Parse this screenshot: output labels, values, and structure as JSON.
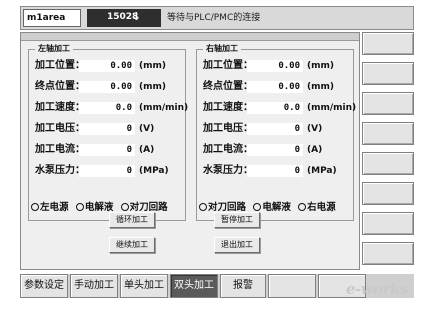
{
  "topbar": {
    "area": "m1area",
    "status_code": "15028",
    "status_arrow": "↓",
    "message": "等待与PLC/PMC的连接"
  },
  "left_group": {
    "title": "左轴加工",
    "rows": [
      {
        "label": "加工位置：",
        "value": "0.00",
        "unit": "(mm)"
      },
      {
        "label": "终点位置：",
        "value": "0.00",
        "unit": "(mm)"
      },
      {
        "label": "加工速度：",
        "value": "0.0",
        "unit": "(mm/min)"
      },
      {
        "label": "加工电压：",
        "value": "0",
        "unit": "(V)"
      },
      {
        "label": "加工电流：",
        "value": "0",
        "unit": "(A)"
      },
      {
        "label": "水泵压力：",
        "value": "0",
        "unit": "(MPa)"
      }
    ],
    "radios": [
      "左电源",
      "电解液",
      "对刀回路"
    ]
  },
  "right_group": {
    "title": "右轴加工",
    "rows": [
      {
        "label": "加工位置：",
        "value": "0.00",
        "unit": "(mm)"
      },
      {
        "label": "终点位置：",
        "value": "0.00",
        "unit": "(mm)"
      },
      {
        "label": "加工速度：",
        "value": "0.0",
        "unit": "(mm/min)"
      },
      {
        "label": "加工电压：",
        "value": "0",
        "unit": "(V)"
      },
      {
        "label": "加工电流：",
        "value": "0",
        "unit": "(A)"
      },
      {
        "label": "水泵压力：",
        "value": "0",
        "unit": "(MPa)"
      }
    ],
    "radios": [
      "对刀回路",
      "电解液",
      "右电源"
    ]
  },
  "buttons": {
    "cycle": "循环加工",
    "pause": "暂停加工",
    "resume": "继续加工",
    "exit": "退出加工"
  },
  "tabs": [
    {
      "label": "参数设定",
      "active": false
    },
    {
      "label": "手动加工",
      "active": false
    },
    {
      "label": "单头加工",
      "active": false
    },
    {
      "label": "双头加工",
      "active": true
    },
    {
      "label": "报警",
      "active": false
    },
    {
      "label": "",
      "active": false
    },
    {
      "label": "",
      "active": false
    }
  ],
  "watermark": "e-works",
  "colors": {
    "panel": "#efefef",
    "active_tab": "#5a5a5a",
    "status_box": "#2e2e2e"
  }
}
